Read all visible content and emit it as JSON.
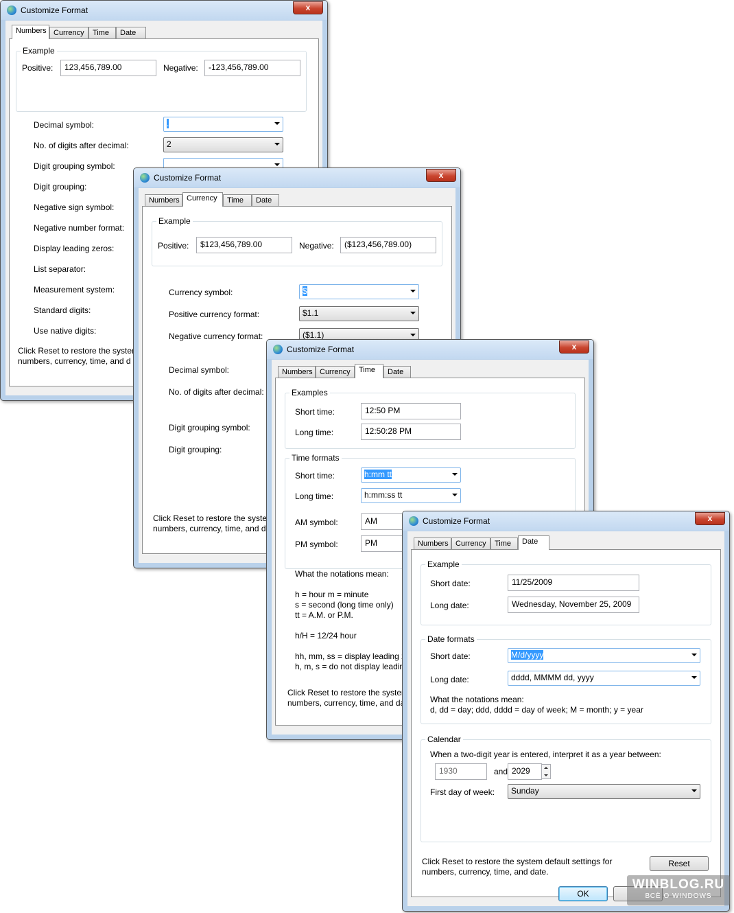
{
  "tabs": {
    "numbers": "Numbers",
    "currency": "Currency",
    "time": "Time",
    "date": "Date"
  },
  "close_label": "x",
  "win1": {
    "title": "Customize Format",
    "example_label": "Example",
    "positive_label": "Positive:",
    "positive_value": "123,456,789.00",
    "negative_label": "Negative:",
    "negative_value": "-123,456,789.00",
    "rows": [
      {
        "label": "Decimal symbol:",
        "value": "."
      },
      {
        "label": "No. of digits after decimal:",
        "value": "2"
      },
      {
        "label": "Digit grouping symbol:",
        "value": ""
      },
      {
        "label": "Digit grouping:"
      },
      {
        "label": "Negative sign symbol:"
      },
      {
        "label": "Negative number format:"
      },
      {
        "label": "Display leading zeros:"
      },
      {
        "label": "List separator:"
      },
      {
        "label": "Measurement system:"
      },
      {
        "label": "Standard digits:"
      },
      {
        "label": "Use native digits:"
      }
    ],
    "reset_text_1": "Click Reset to restore the system",
    "reset_text_2": "numbers, currency, time, and d"
  },
  "win2": {
    "title": "Customize Format",
    "example_label": "Example",
    "positive_label": "Positive:",
    "positive_value": "$123,456,789.00",
    "negative_label": "Negative:",
    "negative_value": "($123,456,789.00)",
    "currency_symbol_label": "Currency symbol:",
    "currency_symbol_value": "$",
    "positive_format_label": "Positive currency format:",
    "positive_format_value": "$1.1",
    "negative_format_label": "Negative currency format:",
    "negative_format_value": "($1.1)",
    "decimal_symbol_label": "Decimal symbol:",
    "digits_after_label": "No. of digits after decimal:",
    "grouping_symbol_label": "Digit grouping symbol:",
    "grouping_label": "Digit grouping:",
    "reset_text_1": "Click Reset to restore the syster",
    "reset_text_2": "numbers, currency, time, and d"
  },
  "win3": {
    "title": "Customize Format",
    "examples_label": "Examples",
    "short_time_label": "Short time:",
    "short_time_value": "12:50 PM",
    "long_time_label": "Long time:",
    "long_time_value": "12:50:28 PM",
    "formats_label": "Time formats",
    "short_time_format_label": "Short time:",
    "short_time_format_value": "h:mm tt",
    "long_time_format_label": "Long time:",
    "long_time_format_value": "h:mm:ss tt",
    "am_label": "AM symbol:",
    "am_value": "AM",
    "pm_label": "PM symbol:",
    "pm_value": "PM",
    "notations": [
      "What the notations mean:",
      "",
      "h = hour   m = minute",
      "s = second (long time only)",
      "tt = A.M. or P.M.",
      "",
      "h/H = 12/24 hour",
      "",
      "hh, mm, ss = display leading z",
      "h, m, s = do not display leadin"
    ],
    "reset_text_1": "Click Reset to restore the system",
    "reset_text_2": "numbers, currency, time, and da"
  },
  "win4": {
    "title": "Customize Format",
    "example_label": "Example",
    "short_date_label": "Short date:",
    "short_date_value": "11/25/2009",
    "long_date_label": "Long date:",
    "long_date_value": "Wednesday, November 25, 2009",
    "formats_label": "Date formats",
    "short_date_format_label": "Short date:",
    "short_date_format_value": "M/d/yyyy",
    "long_date_format_label": "Long date:",
    "long_date_format_value": "dddd, MMMM dd, yyyy",
    "notations_title": "What the notations mean:",
    "notations_text": "d, dd = day;  ddd, dddd = day of week;  M = month;  y = year",
    "calendar_label": "Calendar",
    "two_digit_text": "When a two-digit year is entered, interpret it as a year between:",
    "year_from": "1930",
    "and_label": "and",
    "year_to": "2029",
    "first_day_label": "First day of week:",
    "first_day_value": "Sunday",
    "reset_text_1": "Click Reset to restore the system default settings for",
    "reset_text_2": "numbers, currency, time, and date.",
    "reset_button": "Reset",
    "ok_button": "OK"
  },
  "watermark": {
    "line1": "WINBLOG.RU",
    "line2": "ВСЁ О WINDOWS"
  }
}
